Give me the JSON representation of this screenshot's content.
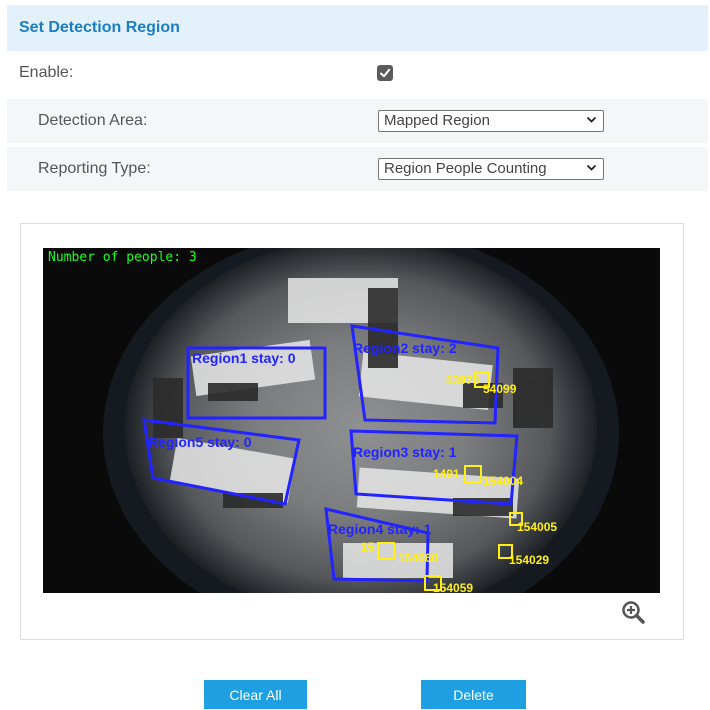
{
  "section": {
    "title": "Set Detection Region"
  },
  "enable": {
    "label": "Enable:",
    "checked": true
  },
  "detection_area": {
    "label": "Detection Area:",
    "value": "Mapped Region"
  },
  "reporting_type": {
    "label": "Reporting Type:",
    "value": "Region People Counting"
  },
  "video": {
    "osd_text": "Number of people: 3",
    "regions": [
      {
        "label": "Region1 stay: 0"
      },
      {
        "label": "Region2 stay: 2"
      },
      {
        "label": "Region3 stay: 1"
      },
      {
        "label": "Region4 stay: 1"
      },
      {
        "label": "Region5 stay: 0"
      }
    ],
    "track_ids": [
      "53978",
      "54099",
      "1491",
      "154004",
      "154005",
      "154029",
      "154060",
      "15",
      "154059"
    ]
  },
  "buttons": {
    "clear_all": "Clear All",
    "delete": "Delete"
  },
  "colors": {
    "accent": "#1e9fe2",
    "header_bg": "#e3f1fb",
    "header_text": "#1b7ec2",
    "region": "#2323ff",
    "track": "#ffef16",
    "osd": "#19ff19"
  },
  "icons": {
    "checkbox": "check-icon",
    "dropdown": "chevron-down-icon",
    "zoom": "zoom-in-icon"
  }
}
